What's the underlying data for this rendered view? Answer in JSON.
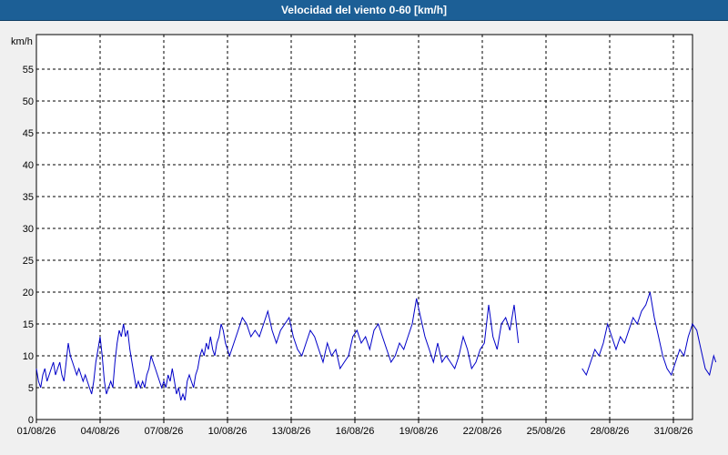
{
  "window": {
    "title": "Velocidad del viento 0-60 [km/h]"
  },
  "chart_data": {
    "type": "line",
    "title": "Velocidad del viento 0-60 [km/h]",
    "ylabel": "km/h",
    "xlabel": "",
    "xlim": [
      "2026-08-01",
      "2026-09-02"
    ],
    "ylim": [
      0,
      60
    ],
    "yticks": [
      0,
      5,
      10,
      15,
      20,
      25,
      30,
      35,
      40,
      45,
      50,
      55
    ],
    "xtick_labels": [
      "01/08/26",
      "04/08/26",
      "07/08/26",
      "10/08/26",
      "13/08/26",
      "16/08/26",
      "19/08/26",
      "22/08/26",
      "25/08/26",
      "28/08/26",
      "31/08/26"
    ],
    "grid": true,
    "color": "#0000c8",
    "series": [
      {
        "gap_after_day": [
          22.7,
          25.7
        ],
        "points": [
          [
            0.0,
            8
          ],
          [
            0.1,
            6
          ],
          [
            0.2,
            5
          ],
          [
            0.3,
            7
          ],
          [
            0.4,
            8
          ],
          [
            0.5,
            6
          ],
          [
            0.6,
            7
          ],
          [
            0.7,
            8
          ],
          [
            0.8,
            9
          ],
          [
            0.9,
            7
          ],
          [
            1.0,
            8
          ],
          [
            1.1,
            9
          ],
          [
            1.2,
            7
          ],
          [
            1.3,
            6
          ],
          [
            1.4,
            9
          ],
          [
            1.5,
            12
          ],
          [
            1.6,
            10
          ],
          [
            1.7,
            9
          ],
          [
            1.8,
            8
          ],
          [
            1.9,
            7
          ],
          [
            2.0,
            8
          ],
          [
            2.1,
            7
          ],
          [
            2.2,
            6
          ],
          [
            2.3,
            7
          ],
          [
            2.4,
            6
          ],
          [
            2.5,
            5
          ],
          [
            2.6,
            4
          ],
          [
            2.7,
            6
          ],
          [
            2.8,
            9
          ],
          [
            2.9,
            11
          ],
          [
            3.0,
            13
          ],
          [
            3.1,
            10
          ],
          [
            3.2,
            6
          ],
          [
            3.3,
            4
          ],
          [
            3.4,
            5
          ],
          [
            3.5,
            6
          ],
          [
            3.6,
            5
          ],
          [
            3.7,
            9
          ],
          [
            3.8,
            12
          ],
          [
            3.9,
            14
          ],
          [
            4.0,
            13
          ],
          [
            4.1,
            15
          ],
          [
            4.2,
            13
          ],
          [
            4.3,
            14
          ],
          [
            4.4,
            11
          ],
          [
            4.5,
            9
          ],
          [
            4.6,
            7
          ],
          [
            4.7,
            5
          ],
          [
            4.8,
            6
          ],
          [
            4.9,
            5
          ],
          [
            5.0,
            6
          ],
          [
            5.1,
            5
          ],
          [
            5.2,
            7
          ],
          [
            5.3,
            8
          ],
          [
            5.4,
            10
          ],
          [
            5.5,
            9
          ],
          [
            5.6,
            8
          ],
          [
            5.7,
            7
          ],
          [
            5.8,
            6
          ],
          [
            5.9,
            5
          ],
          [
            6.0,
            6
          ],
          [
            6.1,
            5
          ],
          [
            6.2,
            7
          ],
          [
            6.3,
            6
          ],
          [
            6.4,
            8
          ],
          [
            6.5,
            6
          ],
          [
            6.6,
            4
          ],
          [
            6.7,
            5
          ],
          [
            6.8,
            3
          ],
          [
            6.9,
            4
          ],
          [
            7.0,
            3
          ],
          [
            7.1,
            6
          ],
          [
            7.2,
            7
          ],
          [
            7.3,
            6
          ],
          [
            7.4,
            5
          ],
          [
            7.5,
            7
          ],
          [
            7.6,
            8
          ],
          [
            7.7,
            10
          ],
          [
            7.8,
            11
          ],
          [
            7.9,
            10
          ],
          [
            8.0,
            12
          ],
          [
            8.1,
            11
          ],
          [
            8.2,
            13
          ],
          [
            8.3,
            11
          ],
          [
            8.4,
            10
          ],
          [
            8.5,
            12
          ],
          [
            8.6,
            13
          ],
          [
            8.7,
            15
          ],
          [
            8.8,
            14
          ],
          [
            8.9,
            12
          ],
          [
            9.0,
            11
          ],
          [
            9.1,
            10
          ],
          [
            9.3,
            12
          ],
          [
            9.5,
            14
          ],
          [
            9.7,
            16
          ],
          [
            9.9,
            15
          ],
          [
            10.1,
            13
          ],
          [
            10.3,
            14
          ],
          [
            10.5,
            13
          ],
          [
            10.7,
            15
          ],
          [
            10.9,
            17
          ],
          [
            11.1,
            14
          ],
          [
            11.3,
            12
          ],
          [
            11.5,
            14
          ],
          [
            11.7,
            15
          ],
          [
            11.9,
            16
          ],
          [
            12.1,
            13
          ],
          [
            12.3,
            11
          ],
          [
            12.5,
            10
          ],
          [
            12.7,
            12
          ],
          [
            12.9,
            14
          ],
          [
            13.1,
            13
          ],
          [
            13.3,
            11
          ],
          [
            13.5,
            9
          ],
          [
            13.7,
            12
          ],
          [
            13.9,
            10
          ],
          [
            14.1,
            11
          ],
          [
            14.3,
            8
          ],
          [
            14.5,
            9
          ],
          [
            14.7,
            10
          ],
          [
            14.9,
            13
          ],
          [
            15.1,
            14
          ],
          [
            15.3,
            12
          ],
          [
            15.5,
            13
          ],
          [
            15.7,
            11
          ],
          [
            15.9,
            14
          ],
          [
            16.1,
            15
          ],
          [
            16.3,
            13
          ],
          [
            16.5,
            11
          ],
          [
            16.7,
            9
          ],
          [
            16.9,
            10
          ],
          [
            17.1,
            12
          ],
          [
            17.3,
            11
          ],
          [
            17.5,
            13
          ],
          [
            17.7,
            15
          ],
          [
            17.9,
            19
          ],
          [
            18.1,
            16
          ],
          [
            18.3,
            13
          ],
          [
            18.5,
            11
          ],
          [
            18.7,
            9
          ],
          [
            18.9,
            12
          ],
          [
            19.1,
            9
          ],
          [
            19.3,
            10
          ],
          [
            19.5,
            9
          ],
          [
            19.7,
            8
          ],
          [
            19.9,
            10
          ],
          [
            20.1,
            13
          ],
          [
            20.3,
            11
          ],
          [
            20.5,
            8
          ],
          [
            20.7,
            9
          ],
          [
            20.9,
            11
          ],
          [
            21.1,
            12
          ],
          [
            21.3,
            18
          ],
          [
            21.5,
            13
          ],
          [
            21.7,
            11
          ],
          [
            21.9,
            15
          ],
          [
            22.1,
            16
          ],
          [
            22.3,
            14
          ],
          [
            22.5,
            18
          ],
          [
            22.7,
            12
          ],
          [
            25.7,
            8
          ],
          [
            25.9,
            7
          ],
          [
            26.1,
            9
          ],
          [
            26.3,
            11
          ],
          [
            26.5,
            10
          ],
          [
            26.7,
            12
          ],
          [
            26.9,
            15
          ],
          [
            27.1,
            13
          ],
          [
            27.3,
            11
          ],
          [
            27.5,
            13
          ],
          [
            27.7,
            12
          ],
          [
            27.9,
            14
          ],
          [
            28.1,
            16
          ],
          [
            28.3,
            15
          ],
          [
            28.5,
            17
          ],
          [
            28.7,
            18
          ],
          [
            28.9,
            20
          ],
          [
            29.1,
            16
          ],
          [
            29.3,
            13
          ],
          [
            29.5,
            10
          ],
          [
            29.7,
            8
          ],
          [
            29.9,
            7
          ],
          [
            30.1,
            9
          ],
          [
            30.3,
            11
          ],
          [
            30.5,
            10
          ],
          [
            30.7,
            13
          ],
          [
            30.9,
            15
          ],
          [
            31.1,
            14
          ],
          [
            31.3,
            11
          ],
          [
            31.5,
            8
          ],
          [
            31.7,
            7
          ],
          [
            31.9,
            10
          ],
          [
            32.0,
            9
          ]
        ]
      }
    ]
  }
}
